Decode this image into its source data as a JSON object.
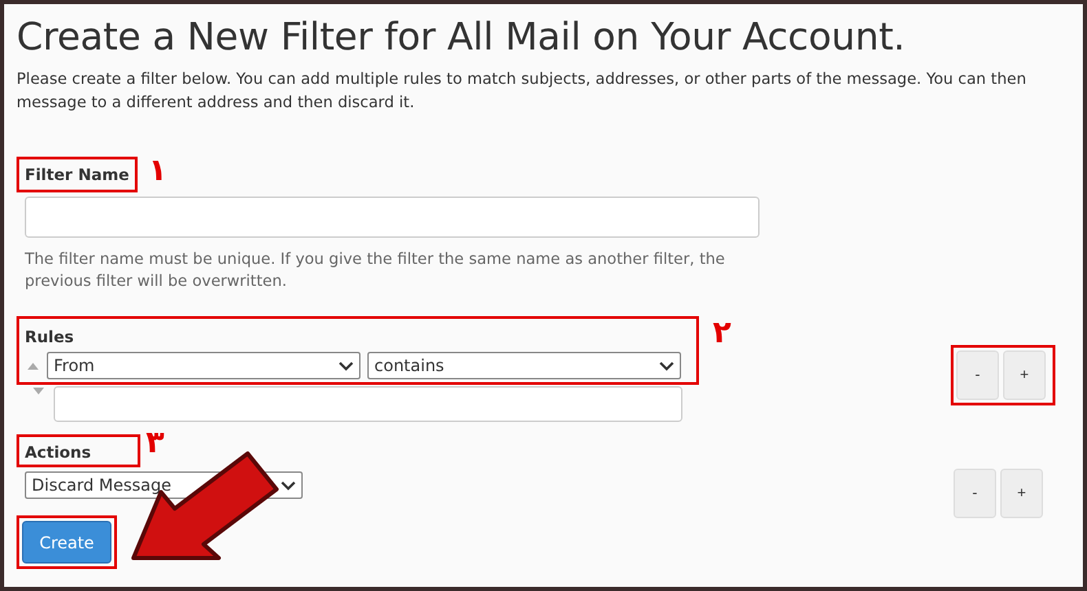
{
  "title": "Create a New Filter for All Mail on Your Account.",
  "description": "Please create a filter below. You can add multiple rules to match subjects, addresses, or other parts of the message. You can then",
  "description_line2": "message to a different address and then discard it.",
  "filter_name": {
    "label": "Filter Name",
    "marker": "۱",
    "help": "The filter name must be unique. If you give the filter the same name as another filter, the previous filter will be overwritten."
  },
  "rules": {
    "label": "Rules",
    "marker": "۲",
    "field": "From",
    "operator": "contains",
    "remove": "-",
    "add": "+"
  },
  "actions": {
    "label": "Actions",
    "marker": "۳",
    "action": "Discard Message",
    "remove": "-",
    "add": "+"
  },
  "create_button": "Create"
}
